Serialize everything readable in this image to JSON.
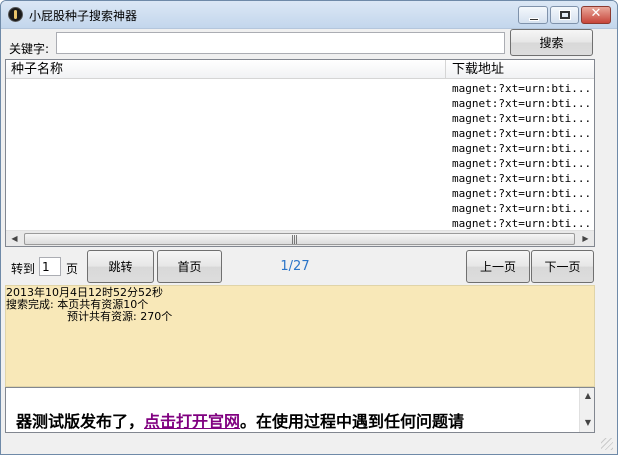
{
  "window": {
    "title": "小屁股种子搜索神器",
    "controls": {
      "minimize": "minimize",
      "maximize": "maximize",
      "close": "✕"
    }
  },
  "search": {
    "label": "关键字:",
    "value": "",
    "button": "搜索"
  },
  "list": {
    "columns": {
      "name": "种子名称",
      "address": "下载地址"
    },
    "rows": [
      {
        "name": "",
        "address": "magnet:?xt=urn:bti..."
      },
      {
        "name": "",
        "address": "magnet:?xt=urn:bti..."
      },
      {
        "name": "",
        "address": "magnet:?xt=urn:bti..."
      },
      {
        "name": "",
        "address": "magnet:?xt=urn:bti..."
      },
      {
        "name": "",
        "address": "magnet:?xt=urn:bti..."
      },
      {
        "name": "",
        "address": "magnet:?xt=urn:bti..."
      },
      {
        "name": "",
        "address": "magnet:?xt=urn:bti..."
      },
      {
        "name": "",
        "address": "magnet:?xt=urn:bti..."
      },
      {
        "name": "",
        "address": "magnet:?xt=urn:bti..."
      },
      {
        "name": "",
        "address": "magnet:?xt=urn:bti..."
      }
    ],
    "scrollbar": {
      "grip": "|||"
    }
  },
  "nav": {
    "goto_label": "转到",
    "page_value": "1",
    "page_unit": "页",
    "jump": "跳转",
    "home": "首页",
    "page_indicator": "1/27",
    "prev": "上一页",
    "next": "下一页"
  },
  "status": {
    "timestamp": "2013年10月4日12时52分52秒",
    "line1": "搜索完成: 本页共有资源10个",
    "line2": "预计共有资源: 270个"
  },
  "banner": {
    "before": "器测试版发布了，",
    "link": "点击打开官网",
    "after": "。在使用过程中遇到任何问题请"
  },
  "colors": {
    "titlebar": "#c3d6ec",
    "status_bg": "#f8e8b8",
    "page_indicator": "#2a74c8",
    "link": "#800080",
    "close_button": "#c7453a"
  }
}
